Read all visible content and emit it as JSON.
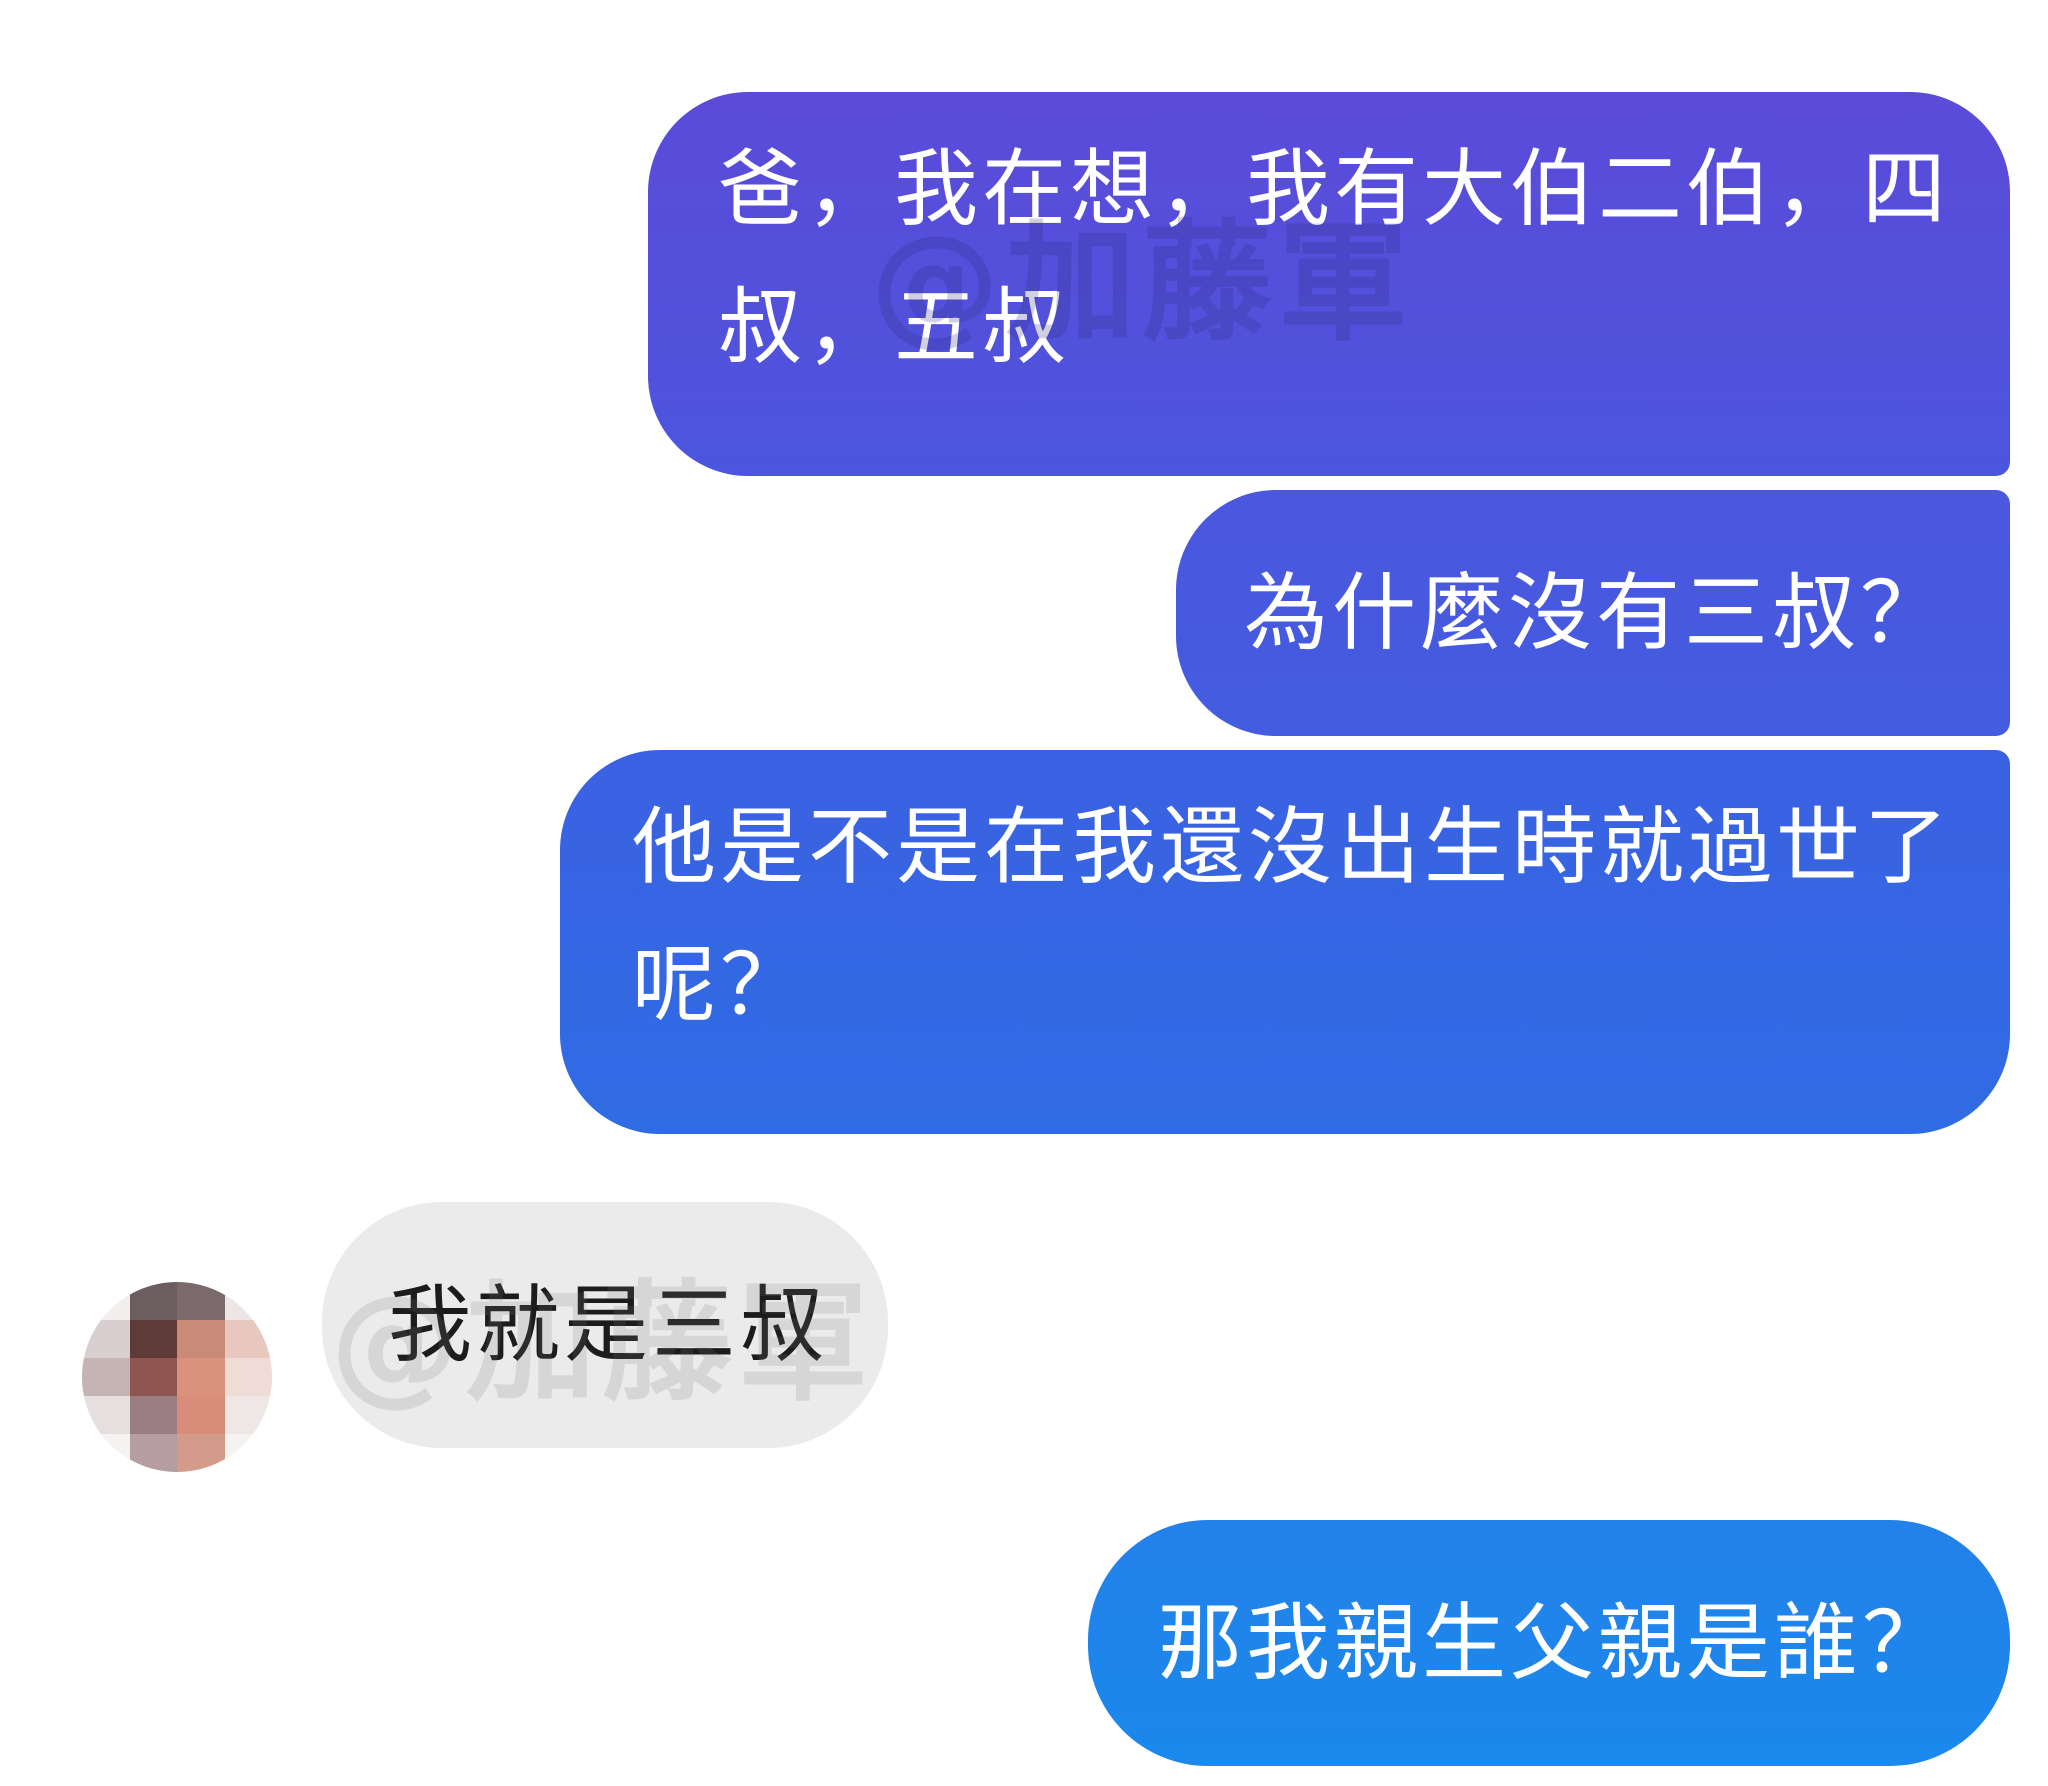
{
  "messages": [
    {
      "direction": "outgoing",
      "text": "爸，我在想，我有大伯二伯，四叔，五叔"
    },
    {
      "direction": "outgoing",
      "text": "為什麼沒有三叔？"
    },
    {
      "direction": "outgoing",
      "text": "他是不是在我還沒出生時就過世了呢？"
    },
    {
      "direction": "incoming",
      "text": "我就是三叔"
    },
    {
      "direction": "outgoing",
      "text": "那我親生父親是誰？"
    }
  ],
  "watermark": {
    "text": "@加藤軍"
  },
  "colors": {
    "incoming_bubble": "#ebebeb",
    "outgoing_top": "#5b4bd9",
    "outgoing_bottom": "#1a88ec",
    "background": "#ffffff"
  }
}
